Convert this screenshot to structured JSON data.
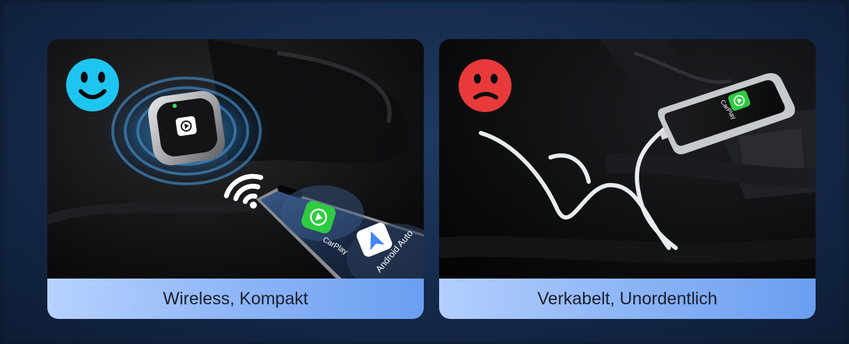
{
  "left_card": {
    "caption": "Wireless, Kompakt",
    "face_color": "#1ec5f0",
    "face_icon": "happy-face-icon",
    "phone_apps": [
      {
        "label": "CarPlay",
        "icon": "carplay-icon",
        "color": "#2ecc40"
      },
      {
        "label": "Android Auto",
        "icon": "android-auto-icon",
        "color": "#ffffff"
      }
    ]
  },
  "right_card": {
    "caption": "Verkabelt, Unordentlich",
    "face_color": "#e83a3a",
    "face_icon": "sad-face-icon",
    "phone_app": {
      "label": "CarPlay",
      "icon": "carplay-icon",
      "color": "#2ecc40"
    }
  }
}
